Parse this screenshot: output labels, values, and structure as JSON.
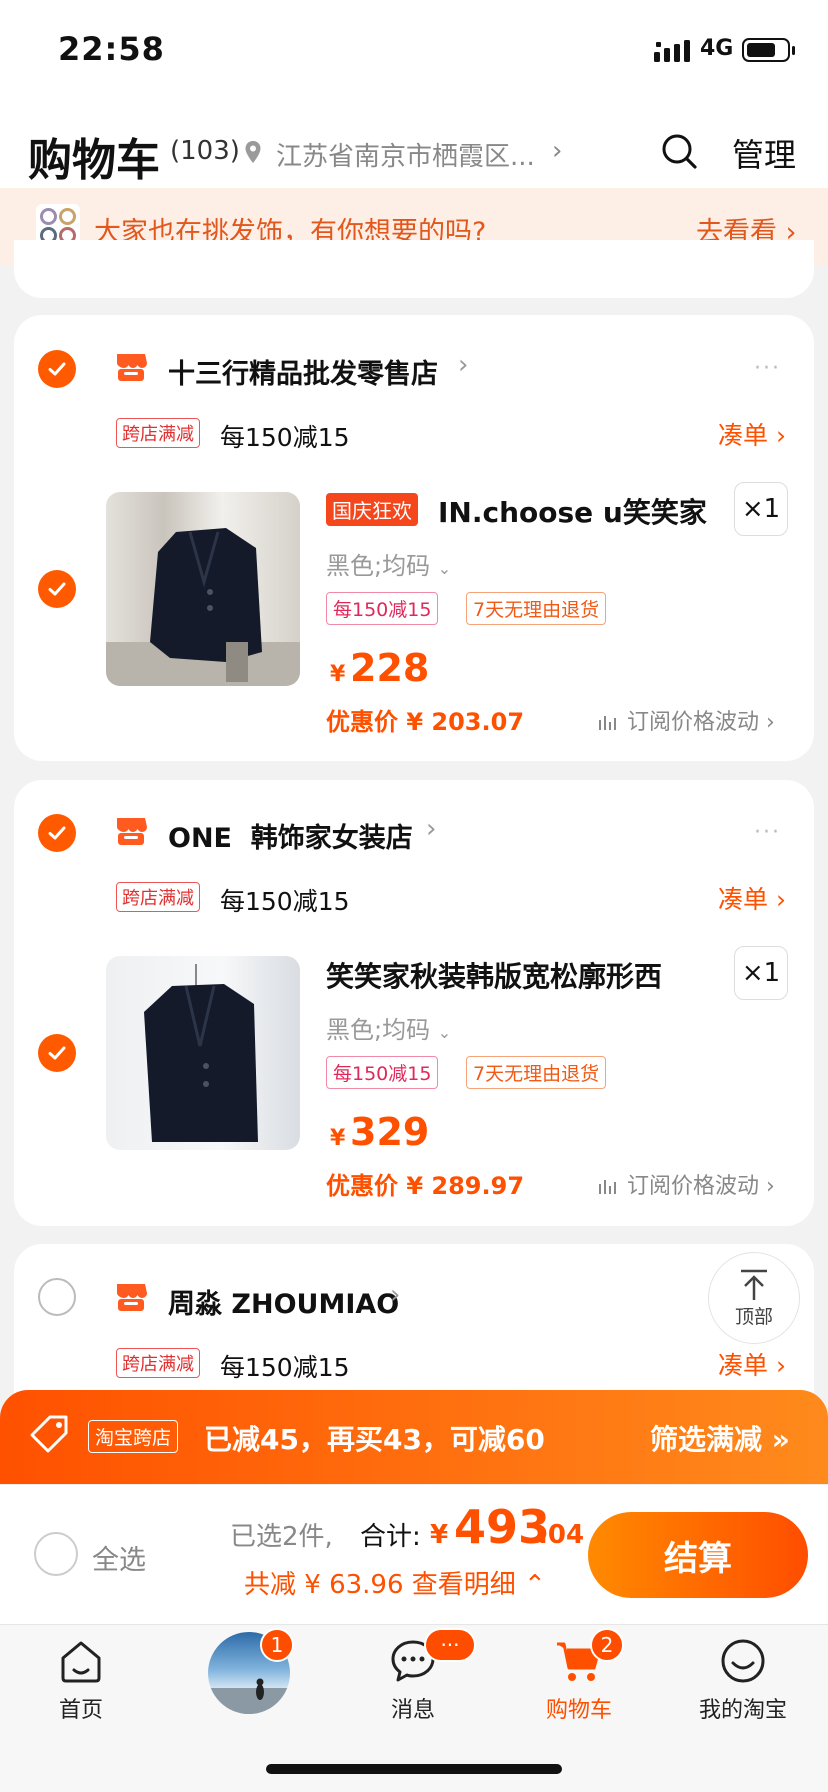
{
  "status_bar": {
    "time": "22:58",
    "network": "4G"
  },
  "header": {
    "title": "购物车",
    "count": "(103)",
    "location": "江苏省南京市栖霞区...",
    "manage": "管理"
  },
  "promo": {
    "text": "大家也在挑发饰，有你想要的吗?",
    "link": "去看看"
  },
  "shops": [
    {
      "name": "十三行精品批发零售店",
      "tag": "跨店满减",
      "discount": "每150减15",
      "coudan": "凑单",
      "product": {
        "badge": "国庆狂欢",
        "title": "IN.choose u笑笑家",
        "qty": "×1",
        "sku": "黑色;均码",
        "tags": [
          "每150减15",
          "7天无理由退货"
        ],
        "price_sym": "¥",
        "price": "228",
        "discount_price": "优惠价 ¥ 203.07",
        "subscribe": "订阅价格波动"
      }
    },
    {
      "name": "ONE  韩饰家女装店",
      "tag": "跨店满减",
      "discount": "每150减15",
      "coudan": "凑单",
      "product": {
        "title": "笑笑家秋装韩版宽松廓形西",
        "qty": "×1",
        "sku": "黑色;均码",
        "tags": [
          "每150减15",
          "7天无理由退货"
        ],
        "price_sym": "¥",
        "price": "329",
        "discount_price": "优惠价 ¥ 289.97",
        "subscribe": "订阅价格波动"
      }
    },
    {
      "name": "周淼 ZHOUMIAO",
      "tag": "跨店满减",
      "discount": "每150减15",
      "coudan": "凑单"
    }
  ],
  "top_button": "顶部",
  "promo_bar": {
    "tag": "淘宝跨店",
    "text": "已减45，再买43，可减60",
    "link": "筛选满减"
  },
  "checkout": {
    "select_all": "全选",
    "selected": "已选2件,",
    "total_label": "合计:",
    "total_sym": "¥",
    "total_int": "493",
    "total_dec": ".04",
    "saved": "共减 ¥ 63.96 查看明细",
    "pay": "结算"
  },
  "tabbar": {
    "items": [
      {
        "label": "首页",
        "icon": "home-icon"
      },
      {
        "label": "",
        "icon": "avatar",
        "badge": "1"
      },
      {
        "label": "消息",
        "icon": "message-icon",
        "badge": "···"
      },
      {
        "label": "购物车",
        "icon": "cart-icon",
        "badge": "2"
      },
      {
        "label": "我的淘宝",
        "icon": "smile-icon"
      }
    ]
  },
  "colors": {
    "accent": "#ff5000",
    "promo_bg": "#fdefe6",
    "bg": "#f2f2f2"
  }
}
